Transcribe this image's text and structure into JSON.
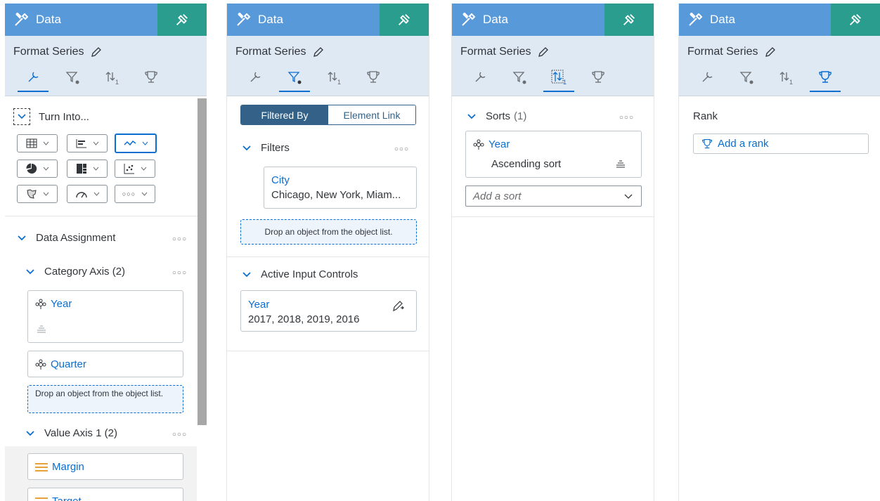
{
  "panels": [
    {
      "header_title": "Data",
      "subtitle": "Format Series"
    },
    {
      "header_title": "Data",
      "subtitle": "Format Series"
    },
    {
      "header_title": "Data",
      "subtitle": "Format Series"
    },
    {
      "header_title": "Data",
      "subtitle": "Format Series"
    }
  ],
  "panel1": {
    "turn_into": "Turn Into...",
    "data_assignment": "Data Assignment",
    "category_axis": "Category Axis (2)",
    "dim_year": "Year",
    "dim_quarter": "Quarter",
    "drop_text": "Drop an object from the object list.",
    "value_axis": "Value Axis 1 (2)",
    "measure_margin": "Margin",
    "measure_target": "Target",
    "more": "○○○"
  },
  "panel2": {
    "seg_filtered_by": "Filtered By",
    "seg_element_link": "Element Link",
    "filters": "Filters",
    "filter_city_label": "City",
    "filter_city_values": "Chicago, New York, Miam...",
    "drop_text": "Drop an object from the object list.",
    "active_input_controls": "Active Input Controls",
    "ic_year_label": "Year",
    "ic_year_values": "2017, 2018, 2019, 2016",
    "more": "○○○"
  },
  "panel3": {
    "sorts": "Sorts",
    "sorts_count": "(1)",
    "sort_dim": "Year",
    "sort_order": "Ascending sort",
    "add_sort_placeholder": "Add a sort",
    "more": "○○○"
  },
  "panel4": {
    "rank_label": "Rank",
    "add_rank": "Add a rank"
  },
  "colors": {
    "header_blue": "#5899da",
    "designer_teal": "#2a9d8f",
    "subheader_bg": "#dfe9f4",
    "accent_blue": "#0a6ed1",
    "segment_active": "#346187"
  },
  "icons": [
    "tools-icon",
    "designer-icon",
    "pencil-icon",
    "wrench-icon",
    "filter-icon",
    "sort-icon",
    "trophy-icon",
    "chevron-down-icon",
    "dimension-icon",
    "measure-icon",
    "table-icon",
    "bar-icon",
    "line-icon",
    "pie-icon",
    "treemap-icon",
    "scatter-icon",
    "geo-icon",
    "gauge-icon",
    "more-icon"
  ]
}
